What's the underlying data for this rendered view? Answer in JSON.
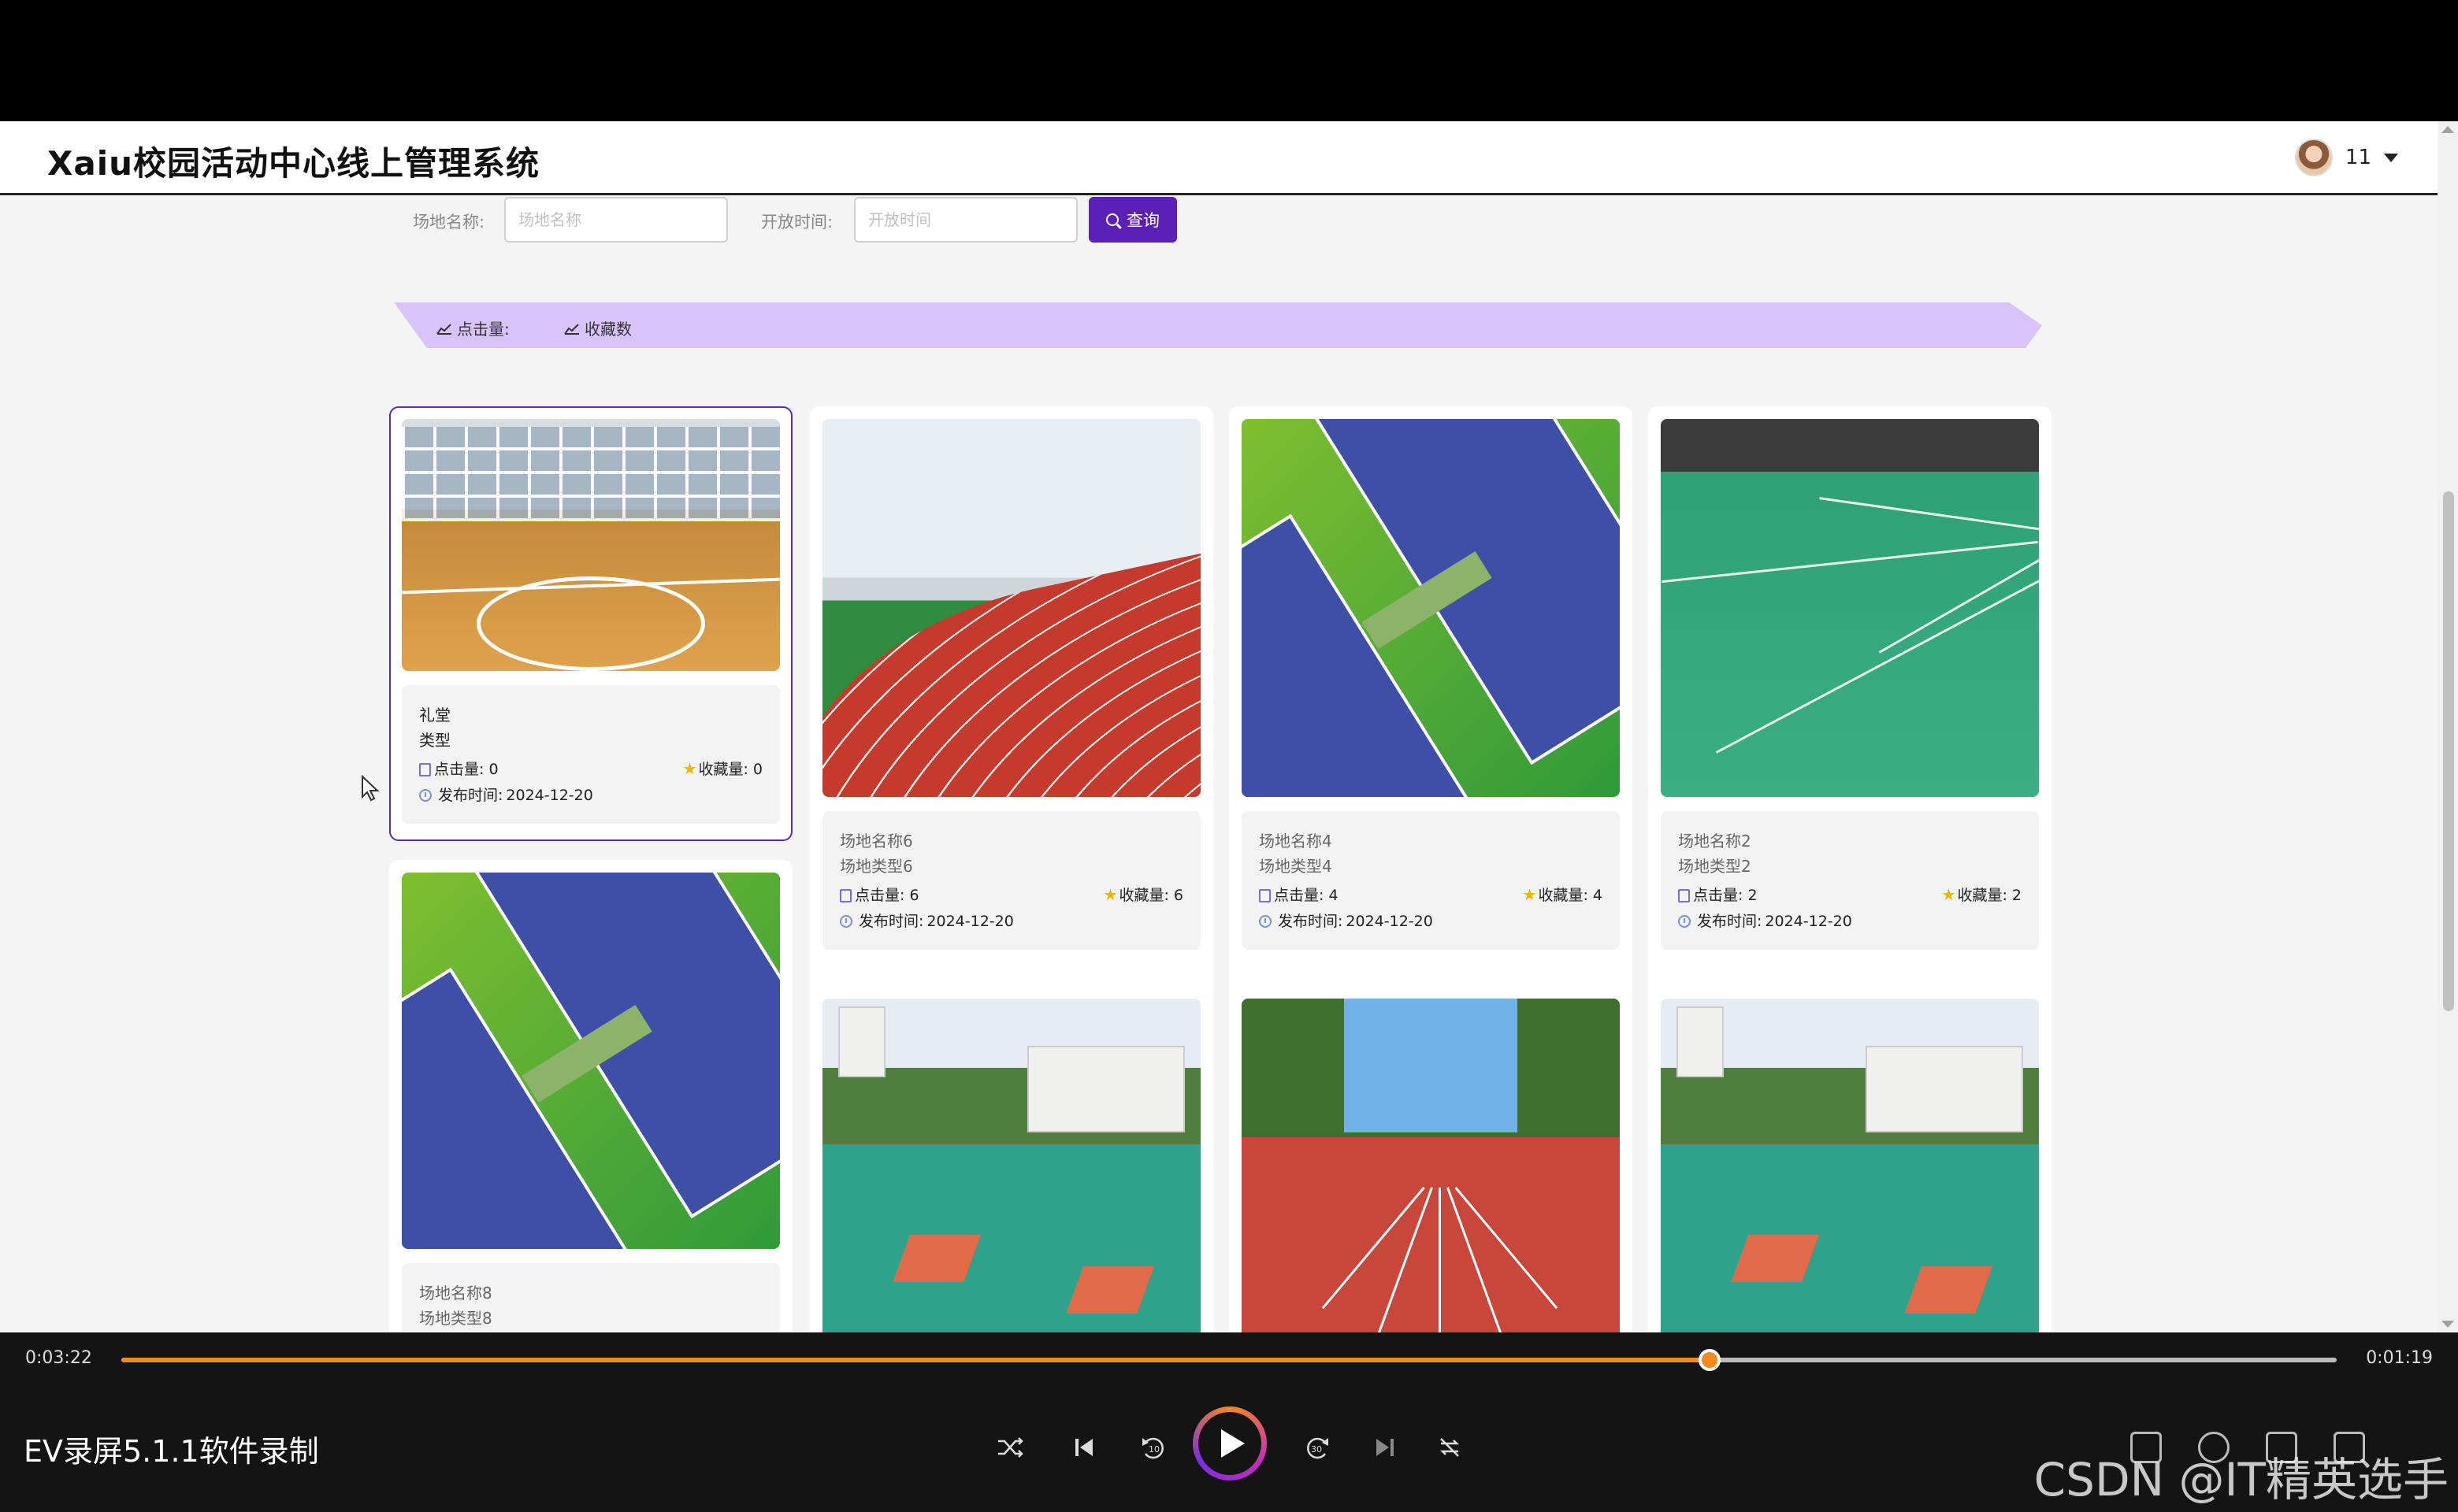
{
  "header": {
    "title": "Xaiu校园活动中心线上管理系统",
    "user_name": "11"
  },
  "search": {
    "venue_label": "场地名称:",
    "venue_placeholder": "场地名称",
    "open_time_label": "开放时间:",
    "open_time_placeholder": "开放时间",
    "query_label": "查询"
  },
  "sort_bar": {
    "clicks_label": "点击量:",
    "favorites_label": "收藏数"
  },
  "cards": [
    {
      "name": "礼堂",
      "type": "类型",
      "clicks_label": "点击量:",
      "clicks": "0",
      "favorites_label": "收藏量:",
      "favorites": "0",
      "date_label": "发布时间:",
      "date": "2024-12-20",
      "scene": "gym"
    },
    {
      "name": "场地名称6",
      "type": "场地类型6",
      "clicks_label": "点击量:",
      "clicks": "6",
      "favorites_label": "收藏量:",
      "favorites": "6",
      "date_label": "发布时间:",
      "date": "2024-12-20",
      "scene": "track"
    },
    {
      "name": "场地名称4",
      "type": "场地类型4",
      "clicks_label": "点击量:",
      "clicks": "4",
      "favorites_label": "收藏量:",
      "favorites": "4",
      "date_label": "发布时间:",
      "date": "2024-12-20",
      "scene": "tennis"
    },
    {
      "name": "场地名称2",
      "type": "场地类型2",
      "clicks_label": "点击量:",
      "clicks": "2",
      "favorites_label": "收藏量:",
      "favorites": "2",
      "date_label": "发布时间:",
      "date": "2024-12-20",
      "scene": "badminton"
    },
    {
      "name": "场地名称8",
      "type": "场地类型8",
      "scene": "tennis"
    },
    {
      "scene": "bball"
    },
    {
      "scene": "runway"
    },
    {
      "scene": "bball"
    }
  ],
  "player": {
    "current_time": "0:03:22",
    "total_time": "0:01:19",
    "progress": 0.717,
    "title": "EV录屏5.1.1软件录制",
    "accent_color": "#f28a1e",
    "controls": [
      "shuffle-icon",
      "previous-icon",
      "rewind-10-icon",
      "play-icon",
      "forward-30-icon",
      "next-icon",
      "loop-icon"
    ]
  },
  "watermark": "CSDN @IT精英选手"
}
